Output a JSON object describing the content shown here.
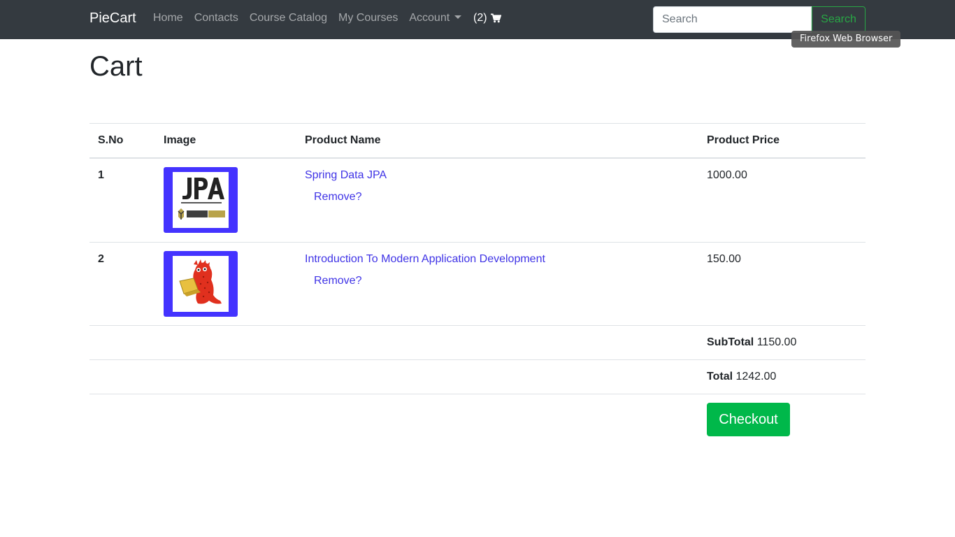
{
  "navbar": {
    "brand": "PieCart",
    "links": [
      "Home",
      "Contacts",
      "Course Catalog",
      "My Courses"
    ],
    "account_label": "Account",
    "cart_count": "(2)",
    "cart_icon": "shopping-cart-icon",
    "search_placeholder": "Search",
    "search_button": "Search",
    "colors": {
      "background": "#343a40",
      "search_accent": "#28a745"
    }
  },
  "tooltip": "Firefox Web Browser",
  "page": {
    "title": "Cart"
  },
  "table": {
    "headers": [
      "S.No",
      "Image",
      "Product Name",
      "Product Price"
    ],
    "rows": [
      {
        "sno": "1",
        "image": "jpa-hibernate-logo",
        "name": "Spring Data JPA",
        "remove": "Remove?",
        "price": "1000.00"
      },
      {
        "sno": "2",
        "image": "red-creature-with-laptop",
        "name": "Introduction To Modern Application Development",
        "remove": "Remove?",
        "price": "150.00"
      }
    ],
    "subtotal_label": "SubTotal",
    "subtotal_value": "1150.00",
    "total_label": "Total",
    "total_value": "1242.00"
  },
  "checkout_button": "Checkout",
  "colors": {
    "link": "#3f33e6",
    "thumb_frame": "#4433ff",
    "checkout": "#00b84a"
  }
}
